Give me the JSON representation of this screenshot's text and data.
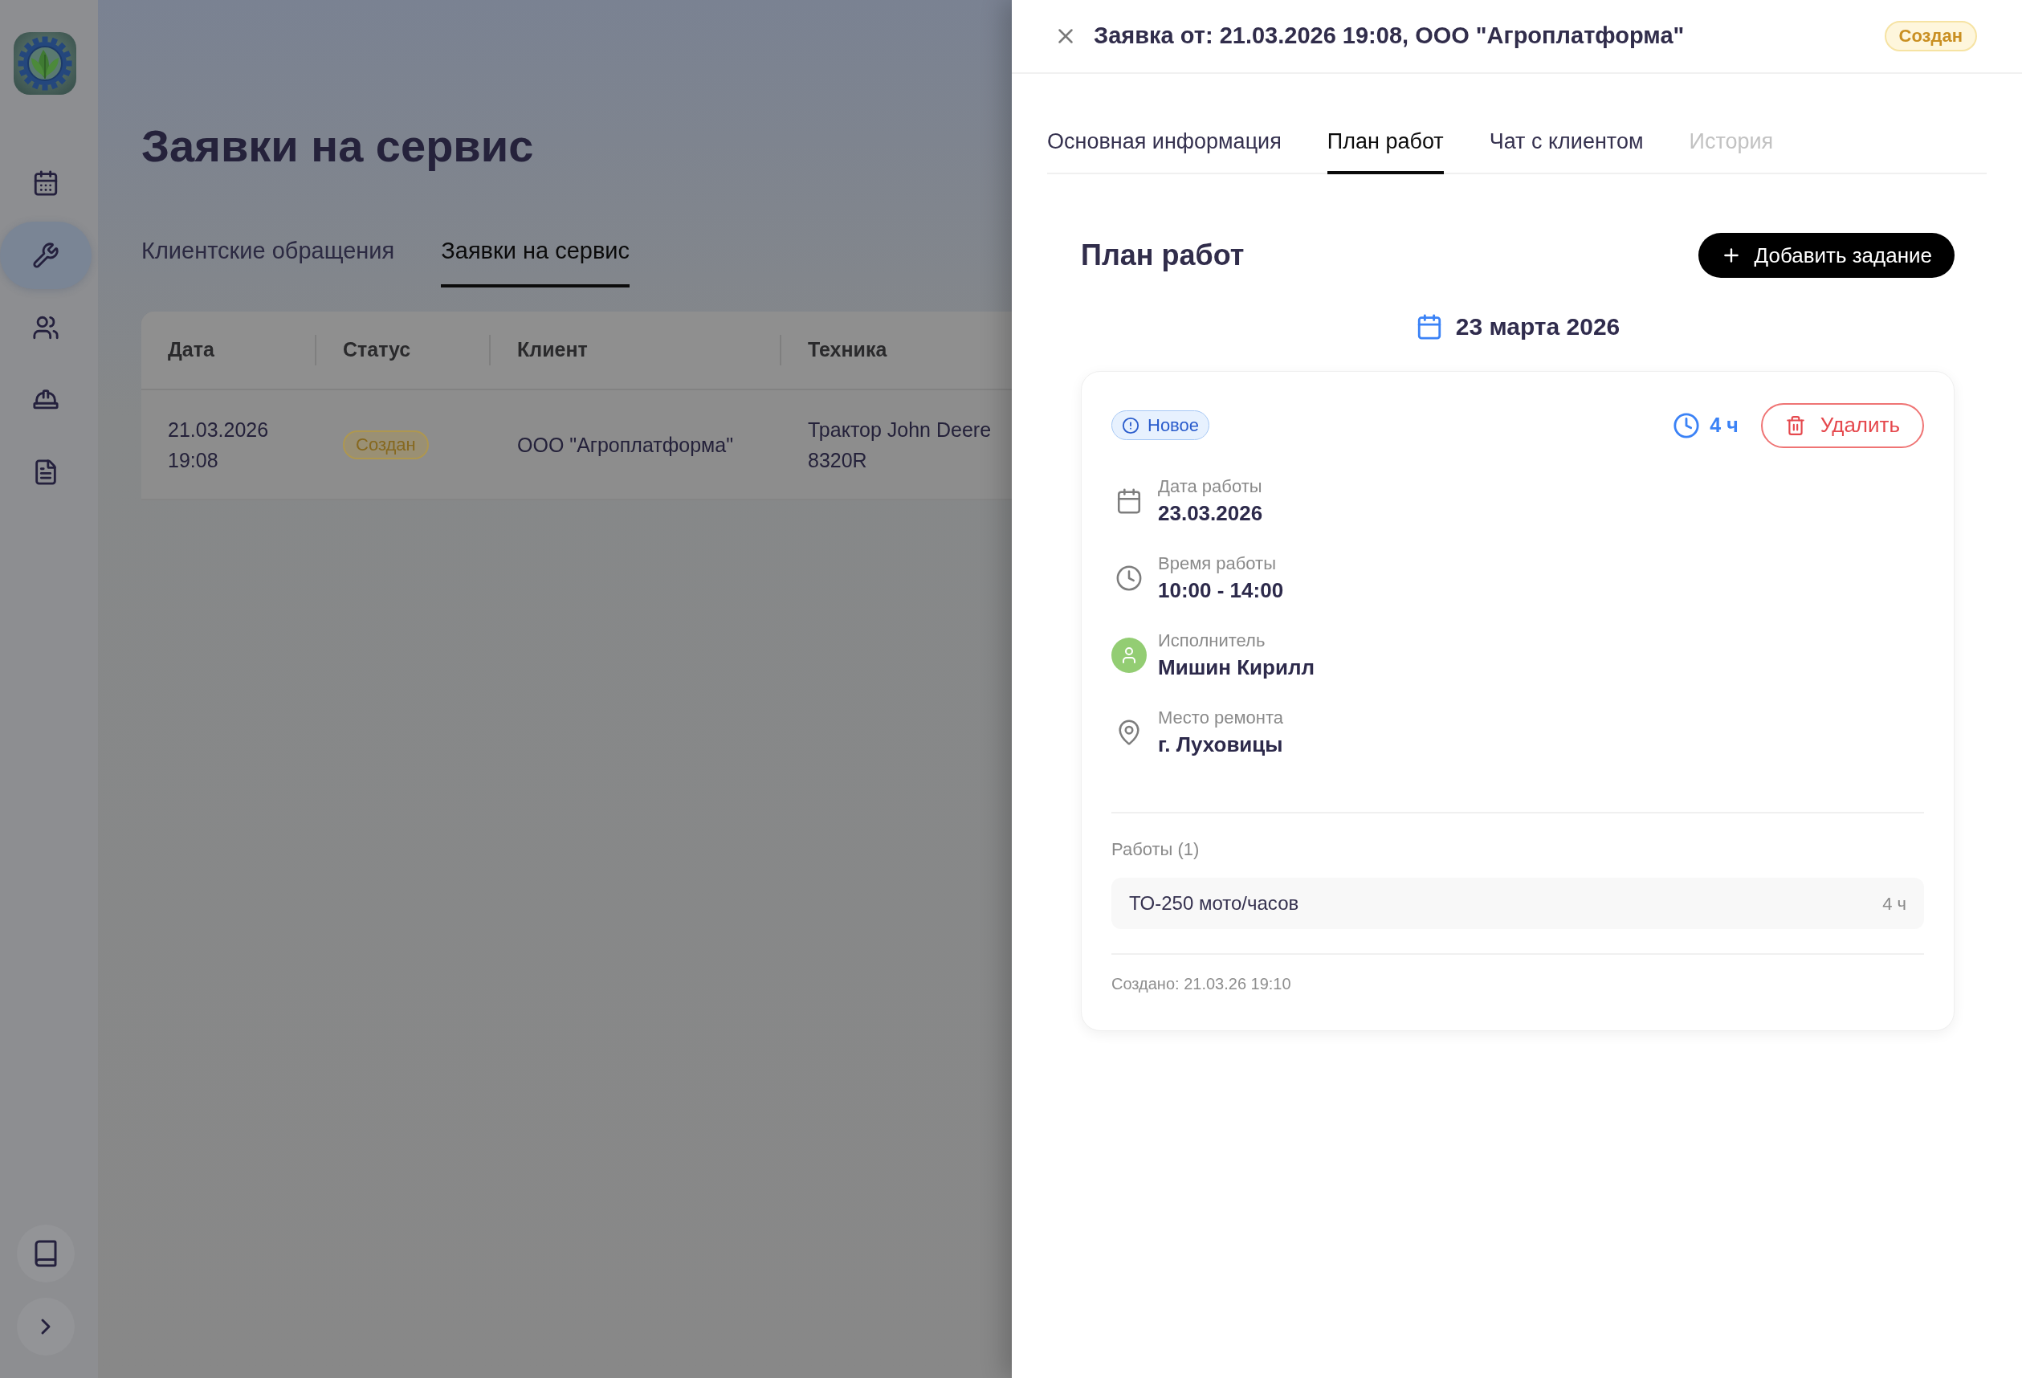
{
  "sidebar": {
    "nav_items": [
      {
        "selected": false
      },
      {
        "selected": true
      },
      {
        "selected": false
      },
      {
        "selected": false
      },
      {
        "selected": false
      }
    ]
  },
  "page": {
    "title": "Заявки на сервис",
    "tabs": [
      {
        "label": "Клиентские обращения",
        "selected": false
      },
      {
        "label": "Заявки на сервис",
        "selected": true
      }
    ],
    "table": {
      "columns": [
        "Дата",
        "Статус",
        "Клиент",
        "Техника"
      ],
      "rows": [
        {
          "date": "21.03.2026 19:08",
          "status": "Создан",
          "client": "ООО \"Агроплатформа\"",
          "equipment": "Трактор John Deere 8320R"
        }
      ]
    }
  },
  "drawer": {
    "title": "Заявка от: 21.03.2026 19:08, ООО \"Агроплатформа\"",
    "status": "Создан",
    "tabs": [
      {
        "label": "Основная информация",
        "selected": false,
        "disabled": false
      },
      {
        "label": "План работ",
        "selected": true,
        "disabled": false
      },
      {
        "label": "Чат с клиентом",
        "selected": false,
        "disabled": false
      },
      {
        "label": "История",
        "selected": false,
        "disabled": true
      }
    ],
    "section_title": "План работ",
    "add_button": "Добавить задание",
    "date_heading": "23 марта 2026",
    "tasks": [
      {
        "status": "Новое",
        "duration": "4 ч",
        "delete_button": "Удалить",
        "fields": [
          {
            "kind": "date",
            "label": "Дата работы",
            "value": "23.03.2026"
          },
          {
            "kind": "time",
            "label": "Время работы",
            "value": "10:00 - 14:00"
          },
          {
            "kind": "person",
            "label": "Исполнитель",
            "value": "Мишин Кирилл"
          },
          {
            "kind": "location",
            "label": "Место ремонта",
            "value": "г. Луховицы"
          }
        ],
        "works_title": "Работы (1)",
        "works": [
          {
            "name": "ТО-250 мото/часов",
            "duration": "4 ч"
          }
        ],
        "created": "Создано: 21.03.26 19:10"
      }
    ]
  }
}
